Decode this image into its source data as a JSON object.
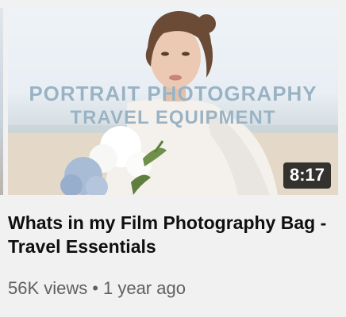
{
  "video": {
    "thumbnail_text_line1": "PORTRAIT PHOTOGRAPHY",
    "thumbnail_text_line2": "TRAVEL EQUIPMENT",
    "duration": "8:17",
    "title": "Whats in my Film Photography Bag - Travel Essentials",
    "views": "56K views",
    "separator": "•",
    "age": "1 year ago"
  },
  "colors": {
    "background": "#f1f1f1",
    "title": "#0f0f0f",
    "meta": "#606060",
    "overlay_text": "#9ab3c4",
    "duration_bg": "#141414"
  }
}
